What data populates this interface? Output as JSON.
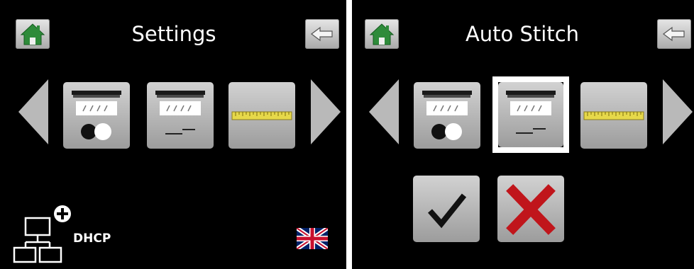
{
  "left_screen": {
    "title": "Settings",
    "network_label": "DHCP",
    "icons": {
      "home": "home-icon",
      "back": "back-arrow-icon",
      "prev": "previous-arrow-icon",
      "next": "next-arrow-icon",
      "tile1": "paper-toggle-icon",
      "tile2": "paper-line-icon",
      "tile3": "ruler-icon",
      "network": "network-add-icon",
      "flag": "uk-flag-icon"
    }
  },
  "right_screen": {
    "title": "Auto Stitch",
    "icons": {
      "home": "home-icon",
      "back": "back-arrow-icon",
      "prev": "previous-arrow-icon",
      "next": "next-arrow-icon",
      "tile1": "paper-toggle-icon",
      "tile2": "paper-line-icon",
      "tile3": "ruler-icon",
      "confirm": "checkmark-icon",
      "cancel": "cross-icon"
    },
    "selected_tile": "tile2"
  },
  "colors": {
    "background": "#000000",
    "house_green": "#2e8b3a",
    "ruler_yellow": "#e6d84a",
    "cancel_red": "#c0151b"
  }
}
